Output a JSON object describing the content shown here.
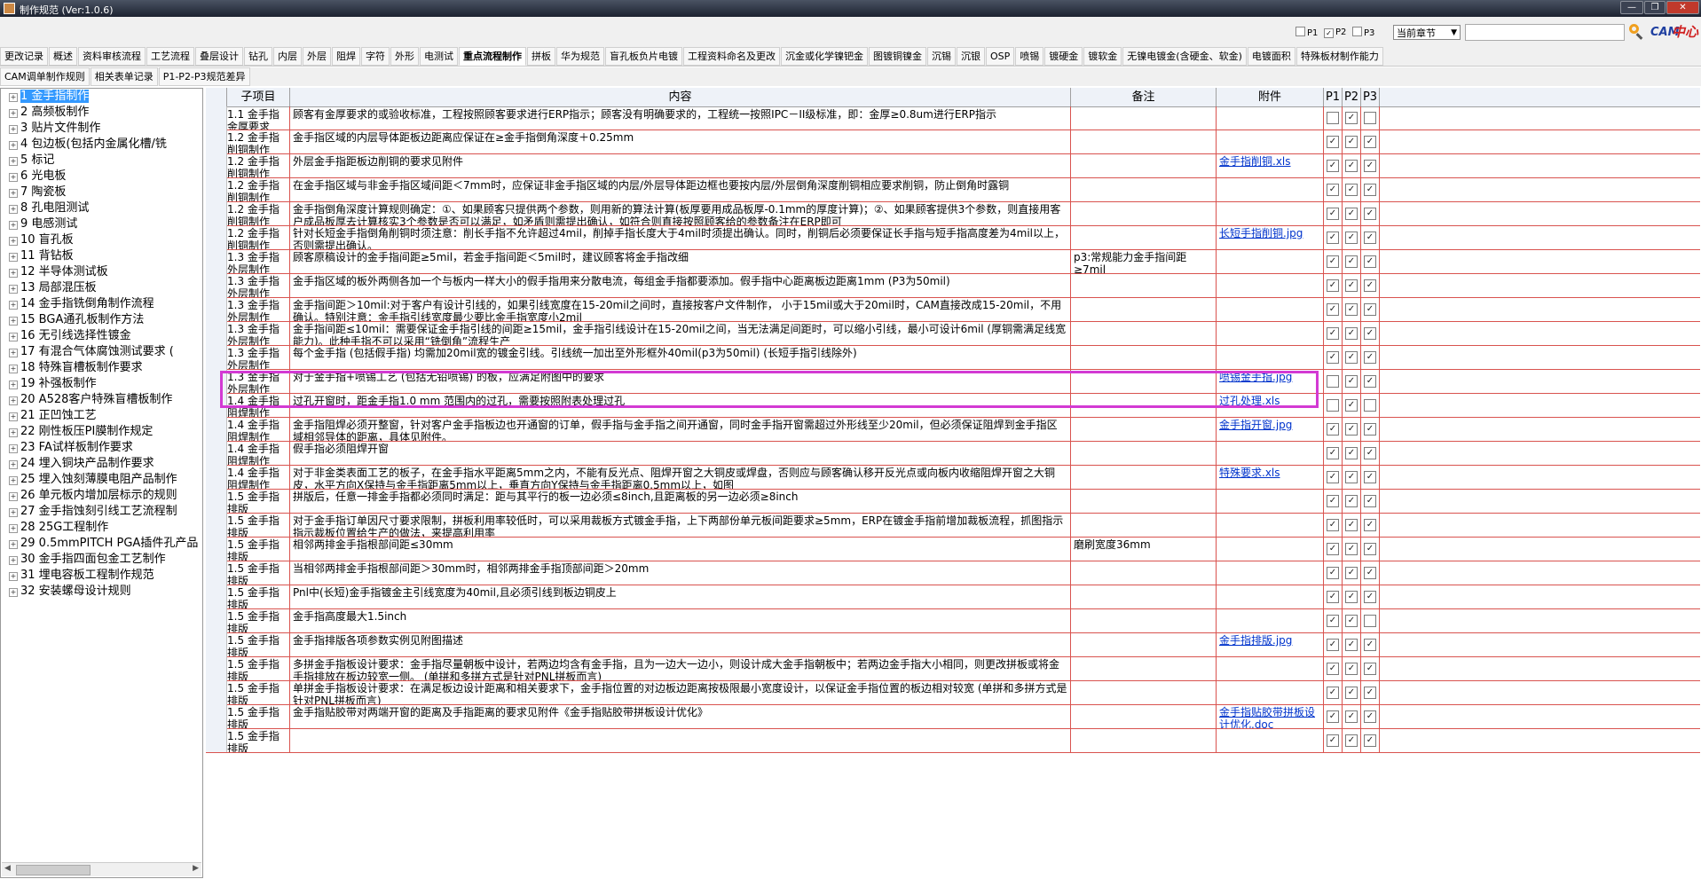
{
  "window": {
    "title": "制作规范 (Ver:1.0.6)",
    "min_label": "—",
    "max_label": "❐",
    "close_label": "✕"
  },
  "toolbar": {
    "filters": [
      {
        "label": "P1",
        "checked": false
      },
      {
        "label": "P2",
        "checked": true
      },
      {
        "label": "P3",
        "checked": false
      }
    ],
    "scope_select": "当前章节",
    "search_value": "",
    "logo_text": "CAM",
    "logo_suffix": "中心"
  },
  "tabs_row1": [
    "更改记录",
    "概述",
    "资料审核流程",
    "工艺流程",
    "叠层设计",
    "钻孔",
    "内层",
    "外层",
    "阻焊",
    "字符",
    "外形",
    "电测试",
    "重点流程制作",
    "拼板",
    "华为规范",
    "盲孔板负片电镀",
    "工程资料命名及更改",
    "沉金或化学镍钯金",
    "图镀铜镍金",
    "沉锡",
    "沉银",
    "OSP",
    "喷锡",
    "镀硬金",
    "镀软金",
    "无镍电镀金(含硬金、软金)",
    "电镀面积",
    "特殊板材制作能力"
  ],
  "active_tab": "重点流程制作",
  "tabs_row2": [
    "CAM调单制作规则",
    "相关表单记录",
    "P1-P2-P3规范差异"
  ],
  "tree": [
    "1 金手指制作",
    "2 高频板制作",
    "3 贴片文件制作",
    "4 包边板(包括内金属化槽/铣",
    "5 标记",
    "6 光电板",
    "7 陶瓷板",
    "8 孔电阻测试",
    "9 电感测试",
    "10 盲孔板",
    "11 背钻板",
    "12 半导体测试板",
    "13 局部混压板",
    "14 金手指铣倒角制作流程",
    "15 BGA通孔板制作方法",
    "16 无引线选择性镀金",
    "17 有混合气体腐蚀测试要求 (",
    "18 特殊盲槽板制作要求",
    "19 补强板制作",
    "20 A528客户特殊盲槽板制作",
    "21 正凹蚀工艺",
    "22 刚性板压PI膜制作规定",
    "23 FA试样板制作要求",
    "24 埋入铜块产品制作要求",
    "25 埋入蚀刻薄膜电阻产品制作",
    "26 单元板内增加层标示的规则",
    "27 金手指蚀刻引线工艺流程制",
    "28 25G工程制作",
    "29 0.5mmPITCH PGA插件孔产品",
    "30 金手指四面包金工艺制作",
    "31 埋电容板工程制作规范",
    "32 安装螺母设计规则"
  ],
  "tree_selected": 0,
  "grid": {
    "headers": {
      "item": "子项目",
      "content": "内容",
      "note": "备注",
      "attachment": "附件",
      "p1": "P1",
      "p2": "P2",
      "p3": "P3"
    },
    "rows": [
      {
        "item": "1.1 金手指金厚要求",
        "content": "顾客有金厚要求的或验收标准，工程按照顾客要求进行ERP指示；顾客没有明确要求的，工程统一按照IPC－II级标准，即：金厚≥0.8um进行ERP指示",
        "note": "",
        "attachment": "",
        "p1": false,
        "p2": true,
        "p3": false
      },
      {
        "item": "1.2 金手指削铜制作",
        "content": "金手指区域的内层导体距板边距离应保证在≥金手指倒角深度＋0.25mm",
        "note": "",
        "attachment": "",
        "p1": true,
        "p2": true,
        "p3": true
      },
      {
        "item": "1.2 金手指削铜制作",
        "content": "外层金手指距板边削铜的要求见附件",
        "note": "",
        "attachment": "金手指削铜.xls",
        "p1": true,
        "p2": true,
        "p3": true
      },
      {
        "item": "1.2 金手指削铜制作",
        "content": "在金手指区域与非金手指区域间距＜7mm时，应保证非金手指区域的内层/外层导体距边框也要按内层/外层倒角深度削铜相应要求削铜，防止倒角时露铜",
        "note": "",
        "attachment": "",
        "p1": true,
        "p2": true,
        "p3": true
      },
      {
        "item": "1.2 金手指削铜制作",
        "content": "金手指倒角深度计算规则确定：①、如果顾客只提供两个参数，则用新的算法计算(板厚要用成品板厚-0.1mm的厚度计算)；②、如果顾客提供3个参数，则直接用客户成品板厚去计算核实3个参数是否可以满足，如矛盾则需提出确认，如符合则直接按照顾客给的参数备注在ERP即可",
        "note": "",
        "attachment": "",
        "p1": true,
        "p2": true,
        "p3": true
      },
      {
        "item": "1.2 金手指削铜制作",
        "content": "针对长短金手指倒角削铜时须注意：削长手指不允许超过4mil，削掉手指长度大于4mil时须提出确认。同时，削铜后必须要保证长手指与短手指高度差为4mil以上，否则需提出确认。",
        "note": "",
        "attachment": "长短手指削铜.jpg",
        "p1": true,
        "p2": true,
        "p3": true
      },
      {
        "item": "1.3 金手指外层制作",
        "content": "顾客原稿设计的金手指间距≥5mil，若金手指间距＜5mil时，建议顾客将金手指改细",
        "note": "p3:常规能力金手指间距≥7mil",
        "attachment": "",
        "p1": true,
        "p2": true,
        "p3": true
      },
      {
        "item": "1.3 金手指外层制作",
        "content": "金手指区域的板外两侧各加一个与板内一样大小的假手指用来分散电流，每组金手指都要添加。假手指中心距离板边距离1mm (P3为50mil)",
        "note": "",
        "attachment": "",
        "p1": true,
        "p2": true,
        "p3": true
      },
      {
        "item": "1.3 金手指外层制作",
        "content": "金手指间距＞10mil:对于客户有设计引线的，如果引线宽度在15-20mil之间时，直接按客户文件制作， 小于15mil或大于20mil时，CAM直接改成15-20mil，不用确认。特别注意：金手指引线宽度最少要比金手指宽度小2mil",
        "note": "",
        "attachment": "",
        "p1": true,
        "p2": true,
        "p3": true
      },
      {
        "item": "1.3 金手指外层制作",
        "content": "金手指间距≤10mil：需要保证金手指引线的间距≥15mil，金手指引线设计在15-20mil之间，当无法满足间距时，可以缩小引线，最小可设计6mil (厚铜需满足线宽能力)。此种手指不可以采用“铣倒角”流程生产",
        "note": "",
        "attachment": "",
        "p1": true,
        "p2": true,
        "p3": true
      },
      {
        "item": "1.3 金手指外层制作",
        "content": "每个金手指 (包括假手指) 均需加20mil宽的镀金引线。引线统一加出至外形框外40mil(p3为50mil) (长短手指引线除外)",
        "note": "",
        "attachment": "",
        "p1": true,
        "p2": true,
        "p3": true
      },
      {
        "item": "1.3 金手指外层制作",
        "content": "对于金手指+喷锡工艺 (包括无铅喷锡) 的板，应满足附图中的要求",
        "note": "",
        "attachment": "喷锡金手指.jpg",
        "p1": false,
        "p2": true,
        "p3": true
      },
      {
        "item": "1.4 金手指阻焊制作",
        "content": "过孔开窗时，距金手指1.0 mm 范围内的过孔，需要按照附表处理过孔",
        "note": "",
        "attachment": "过孔处理.xls",
        "p1": false,
        "p2": true,
        "p3": false
      },
      {
        "item": "1.4 金手指阻焊制作",
        "content": "金手指阻焊必须开整窗，针对客户金手指板边也开通窗的订单，假手指与金手指之间开通窗，同时金手指开窗需超过外形线至少20mil，但必须保证阻焊到金手指区域相邻导体的距离，具体见附件。",
        "note": "",
        "attachment": "金手指开窗.jpg",
        "p1": true,
        "p2": true,
        "p3": true
      },
      {
        "item": "1.4 金手指阻焊制作",
        "content": "假手指必须阻焊开窗",
        "note": "",
        "attachment": "",
        "p1": true,
        "p2": true,
        "p3": true
      },
      {
        "item": "1.4 金手指阻焊制作",
        "content": "对于非金类表面工艺的板子，在金手指水平距离5mm之内，不能有反光点、阻焊开窗之大铜皮或焊盘，否则应与顾客确认移开反光点或向板内收缩阻焊开窗之大铜皮，水平方向X保持与金手指距离5mm以上，垂直方向Y保持与金手指距离0.5mm以上，如图",
        "note": "",
        "attachment": "特殊要求.xls",
        "p1": true,
        "p2": true,
        "p3": true
      },
      {
        "item": "1.5 金手指排版",
        "content": "拼版后，任意一排金手指都必须同时满足：距与其平行的板一边必须≤8inch,且距离板的另一边必须≥8inch",
        "note": "",
        "attachment": "",
        "p1": true,
        "p2": true,
        "p3": true
      },
      {
        "item": "1.5 金手指排版",
        "content": "对于金手指订单因尺寸要求限制，拼板利用率较低时，可以采用裁板方式镀金手指，上下两部份单元板间距要求≥5mm，ERP在镀金手指前增加裁板流程，抓图指示指示裁板位置给生产的做法，来提高利用率",
        "note": "",
        "attachment": "",
        "p1": true,
        "p2": true,
        "p3": true
      },
      {
        "item": "1.5 金手指排版",
        "content": "相邻两排金手指根部间距≤30mm",
        "note": "磨刷宽度36mm",
        "attachment": "",
        "p1": true,
        "p2": true,
        "p3": true
      },
      {
        "item": "1.5 金手指排版",
        "content": "当相邻两排金手指根部间距＞30mm时，相邻两排金手指顶部间距＞20mm",
        "note": "",
        "attachment": "",
        "p1": true,
        "p2": true,
        "p3": true
      },
      {
        "item": "1.5 金手指排版",
        "content": "Pnl中(长短)金手指镀金主引线宽度为40mil,且必须引线到板边铜皮上",
        "note": "",
        "attachment": "",
        "p1": true,
        "p2": true,
        "p3": true
      },
      {
        "item": "1.5 金手指排版",
        "content": "金手指高度最大1.5inch",
        "note": "",
        "attachment": "",
        "p1": true,
        "p2": true,
        "p3": false
      },
      {
        "item": "1.5 金手指排版",
        "content": "金手指排版各项参数实例见附图描述",
        "note": "",
        "attachment": "金手指排版.jpg",
        "p1": true,
        "p2": true,
        "p3": true
      },
      {
        "item": "1.5 金手指排版",
        "content": "多拼金手指板设计要求：金手指尽量朝板中设计，若两边均含有金手指，且为一边大一边小，则设计成大金手指朝板中；若两边金手指大小相同，则更改拼板或将金手指排放在板边较宽一侧。 (单拼和多拼方式是针对PNL拼板而言)",
        "note": "",
        "attachment": "",
        "p1": true,
        "p2": true,
        "p3": true
      },
      {
        "item": "1.5 金手指排版",
        "content": "单拼金手指板设计要求：在满足板边设计距离和相关要求下，金手指位置的对边板边距离按极限最小宽度设计，以保证金手指位置的板边相对较宽 (单拼和多拼方式是针对PNL拼板而言)",
        "note": "",
        "attachment": "",
        "p1": true,
        "p2": true,
        "p3": true
      },
      {
        "item": "1.5 金手指排版",
        "content": "金手指贴胶带对两端开窗的距离及手指距离的要求见附件《金手指贴胶带拼板设计优化》",
        "note": "",
        "attachment": "金手指贴胶带拼板设计优化.doc",
        "p1": true,
        "p2": true,
        "p3": true
      },
      {
        "item": "1.5 金手指排版",
        "content": "",
        "note": "",
        "attachment": "",
        "p1": true,
        "p2": true,
        "p3": true
      }
    ]
  }
}
